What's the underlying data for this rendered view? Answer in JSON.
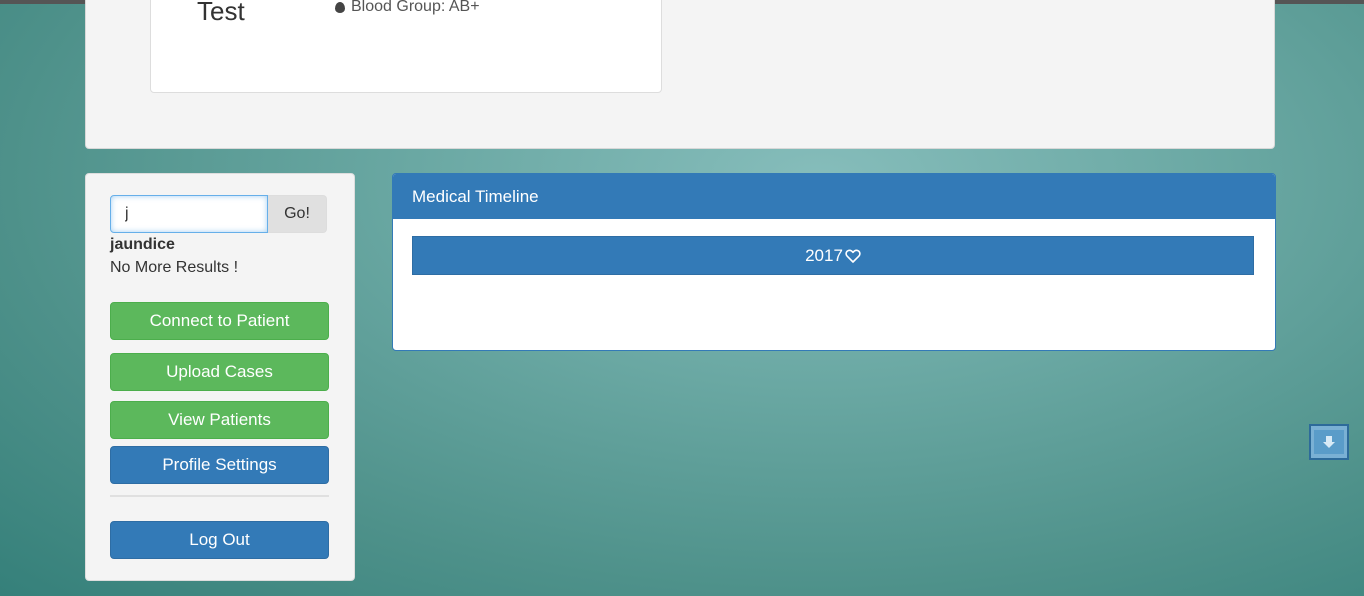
{
  "profile": {
    "name": "Test",
    "blood_group": "Blood Group: AB+"
  },
  "search": {
    "value": "j",
    "go_label": "Go!",
    "suggestion": "jaundice",
    "no_results": "No More Results !"
  },
  "sidebar": {
    "connect_label": "Connect to Patient",
    "upload_label": "Upload Cases",
    "view_label": "View Patients",
    "settings_label": "Profile Settings",
    "logout_label": "Log Out"
  },
  "timeline": {
    "heading": "Medical Timeline",
    "year": "2017"
  },
  "icons": {
    "blood": "drop-icon",
    "year": "heart-icon",
    "scroll": "arrow-down-icon"
  },
  "colors": {
    "primary": "#337ab7",
    "success": "#5cb85c"
  }
}
